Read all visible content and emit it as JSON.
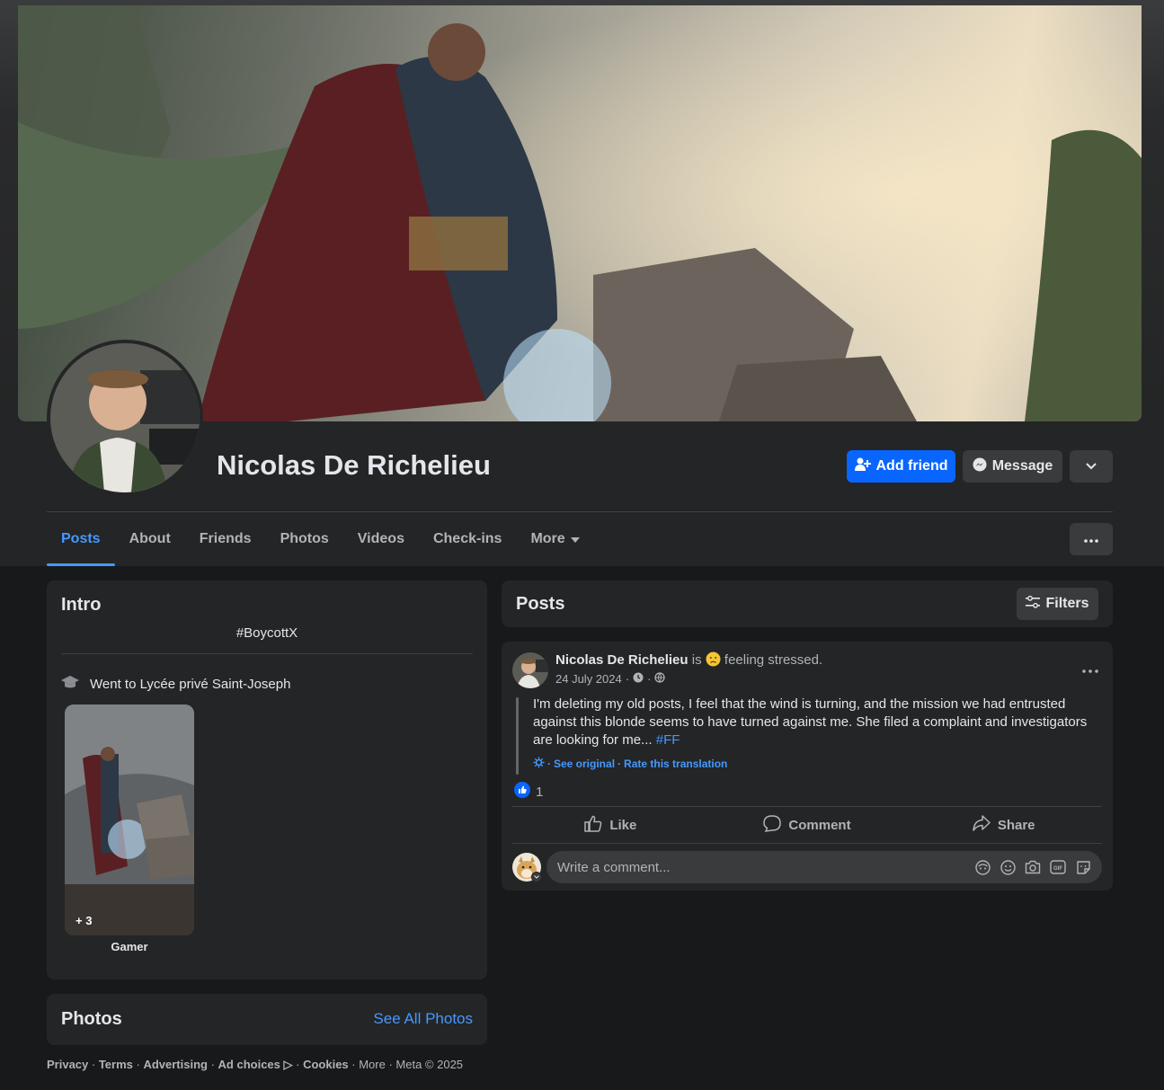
{
  "profile": {
    "name": "Nicolas De Richelieu"
  },
  "header_actions": {
    "add_friend": "Add friend",
    "message": "Message"
  },
  "tabs": [
    {
      "label": "Posts"
    },
    {
      "label": "About"
    },
    {
      "label": "Friends"
    },
    {
      "label": "Photos"
    },
    {
      "label": "Videos"
    },
    {
      "label": "Check-ins"
    },
    {
      "label": "More"
    }
  ],
  "intro": {
    "title": "Intro",
    "bio": "#BoycottX",
    "education": "Went to Lycée privé Saint-Joseph",
    "featured_count": "+ 3",
    "featured_label": "Gamer"
  },
  "photos_card": {
    "title": "Photos",
    "see_all": "See All Photos"
  },
  "footer": {
    "privacy": "Privacy",
    "terms": "Terms",
    "advertising": "Advertising",
    "ad_choices": "Ad choices",
    "cookies": "Cookies",
    "more": "More",
    "meta": "Meta © 2025"
  },
  "posts_header": {
    "title": "Posts",
    "filters": "Filters"
  },
  "post": {
    "author": "Nicolas De Richelieu",
    "is": "is",
    "feeling": "feeling stressed.",
    "date": "24 July 2024",
    "text": "I'm deleting my old posts, I feel that the wind is turning, and the mission we had entrusted against this blonde seems to have turned against me. She filed a complaint and investigators are looking for me...",
    "hashtag": "#FF",
    "see_original": "See original",
    "rate_translation": "Rate this translation",
    "reaction_count": "1",
    "like": "Like",
    "comment": "Comment",
    "share": "Share",
    "comment_placeholder": "Write a comment..."
  },
  "icons": {
    "add_friend": "person-plus-icon",
    "message": "messenger-icon",
    "dropdown": "chevron-down-icon",
    "more_tab": "caret-down-icon",
    "tab_menu": "more-horizontal-icon",
    "education": "graduation-cap-icon",
    "filters": "sliders-icon",
    "post_menu": "more-horizontal-icon",
    "visibility": "globe-icon",
    "like": "thumbs-up-icon",
    "comment": "speech-bubble-icon",
    "share": "share-arrow-icon"
  },
  "colors": {
    "accent": "#0866ff",
    "link": "#4599ff",
    "background": "#18191a",
    "card": "#242526"
  }
}
